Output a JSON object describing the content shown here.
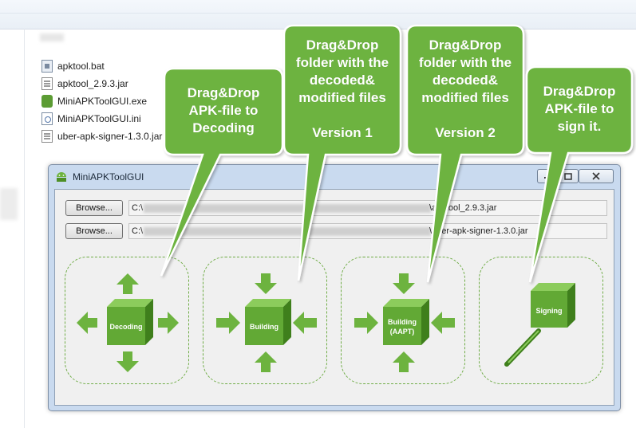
{
  "explorer": {
    "files": [
      {
        "name": "apktool.bat",
        "icon": "bat-file-icon"
      },
      {
        "name": "apktool_2.9.3.jar",
        "icon": "jar-file-icon"
      },
      {
        "name": "MiniAPKToolGUI.exe",
        "icon": "exe-file-icon"
      },
      {
        "name": "MiniAPKToolGUI.ini",
        "icon": "ini-file-icon"
      },
      {
        "name": "uber-apk-signer-1.3.0.jar",
        "icon": "jar-file-icon"
      }
    ]
  },
  "window": {
    "title": "MiniAPKToolGUI",
    "browse1_label": "Browse...",
    "path1_drive": "C:\\",
    "path1_tail": "\\apktool_2.9.3.jar",
    "browse2_label": "Browse...",
    "path2_drive": "C:\\",
    "path2_tail": "\\uber-apk-signer-1.3.0.jar"
  },
  "zones": {
    "decoding": "Decoding",
    "building": "Building",
    "building_aapt_line1": "Building",
    "building_aapt_line2": "(AAPT)",
    "signing": "Signing"
  },
  "callouts": {
    "c1": {
      "line1": "Drag&Drop",
      "line2": "APK-file to",
      "line3": "Decoding"
    },
    "c2": {
      "line1": "Drag&Drop",
      "line2": "folder with the",
      "line3": "decoded&",
      "line4": "modified files",
      "line5": "Version 1"
    },
    "c3": {
      "line1": "Drag&Drop",
      "line2": "folder with the",
      "line3": "decoded&",
      "line4": "modified files",
      "line5": "Version 2"
    },
    "c4": {
      "line1": "Drag&Drop",
      "line2": "APK-file to",
      "line3": "sign it."
    }
  },
  "colors": {
    "accent_green": "#6db33f",
    "dark_green": "#4e8f25",
    "callout_border": "#5aa832"
  }
}
